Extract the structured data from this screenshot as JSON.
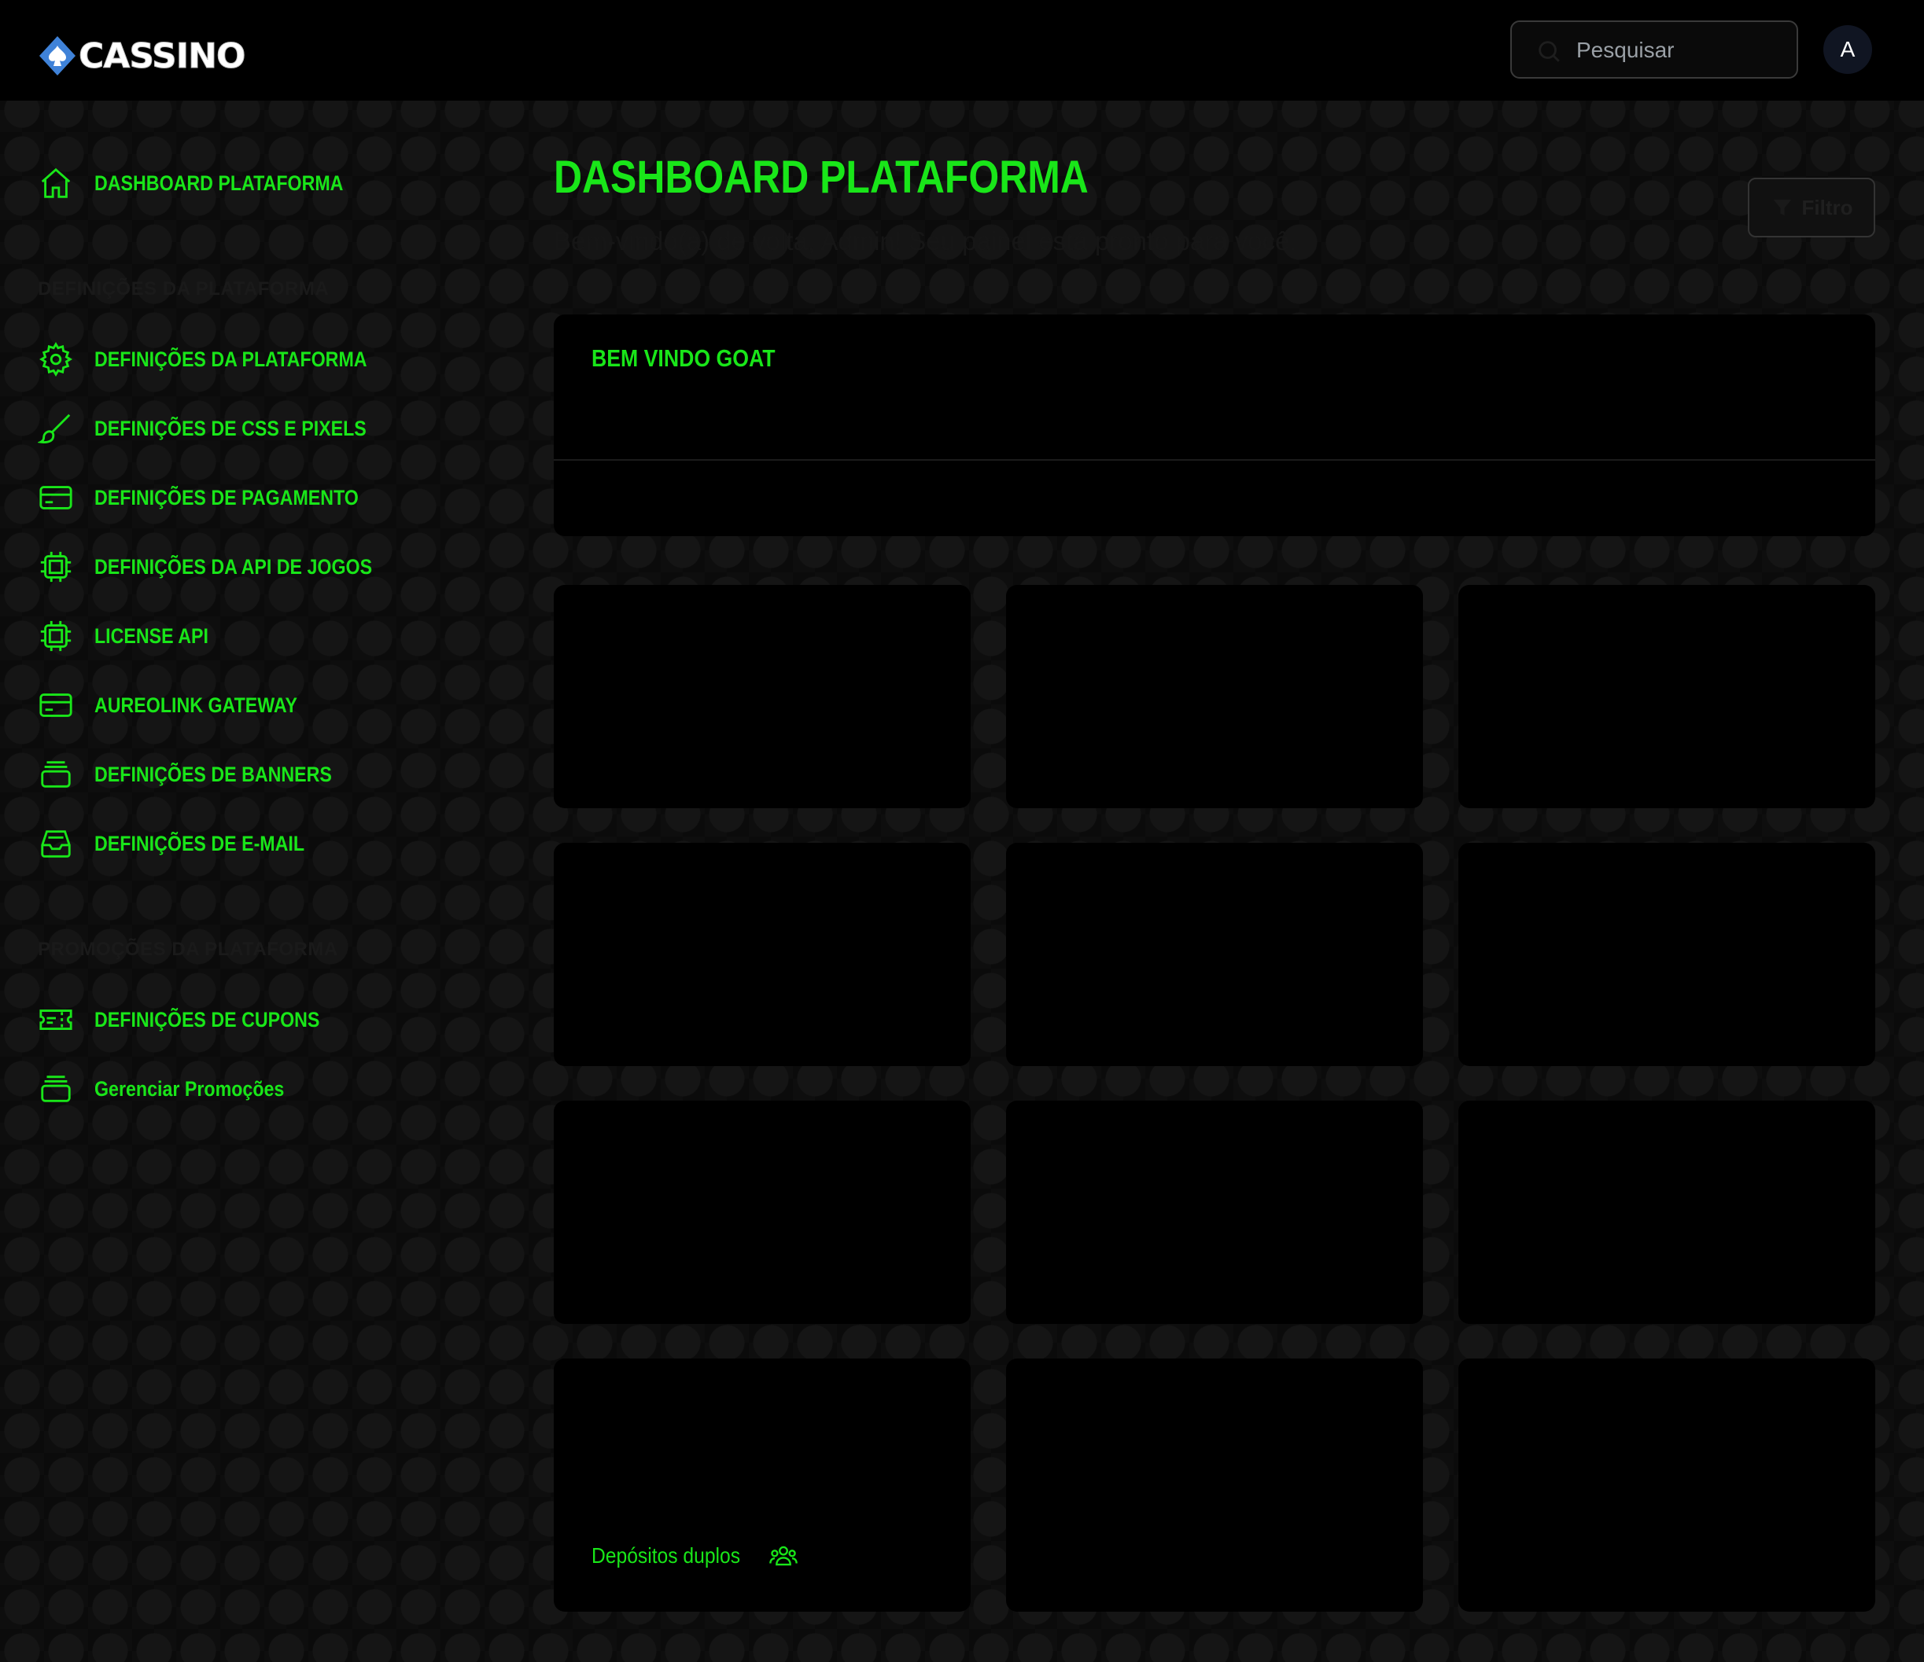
{
  "app": {
    "logo_text": "CASSINO"
  },
  "search": {
    "placeholder": "Pesquisar"
  },
  "user": {
    "avatar_initial": "A"
  },
  "sidebar": {
    "items_top": [
      {
        "label": "DASHBOARD PLATAFORMA",
        "icon": "home-icon"
      }
    ],
    "section_settings": "DEFINIÇÕES DA PLATAFORMA",
    "items_settings": [
      {
        "label": "DEFINIÇÕES DA PLATAFORMA",
        "icon": "gear-icon"
      },
      {
        "label": "DEFINIÇÕES DE CSS E PIXELS",
        "icon": "brush-icon"
      },
      {
        "label": "DEFINIÇÕES DE PAGAMENTO",
        "icon": "credit-card-icon"
      },
      {
        "label": "DEFINIÇÕES DA API DE JOGOS",
        "icon": "chip-icon"
      },
      {
        "label": "LICENSE API",
        "icon": "chip-icon"
      },
      {
        "label": "AUREOLINK GATEWAY",
        "icon": "credit-card-icon"
      },
      {
        "label": "DEFINIÇÕES DE BANNERS",
        "icon": "stack-icon"
      },
      {
        "label": "DEFINIÇÕES DE E-MAIL",
        "icon": "inbox-icon"
      }
    ],
    "section_promos": "PROMOÇÕES DA PLATAFORMA",
    "items_promos": [
      {
        "label": "DEFINIÇÕES DE CUPONS",
        "icon": "ticket-icon"
      },
      {
        "label": "Gerenciar Promoções",
        "icon": "stack-icon"
      }
    ]
  },
  "main": {
    "title": "DASHBOARD PLATAFORMA",
    "subtitle": "Bem-vindo(a) de volta, Admin! Seu painel está pronto para você.",
    "filter_label": "Filtro",
    "welcome_title": "BEM VINDO GOAT",
    "deposit_link": "Depósitos duplos"
  },
  "colors": {
    "accent": "#19e619",
    "background": "#0b0b0b",
    "card": "#000000",
    "logo_blue": "#3f82d8"
  }
}
